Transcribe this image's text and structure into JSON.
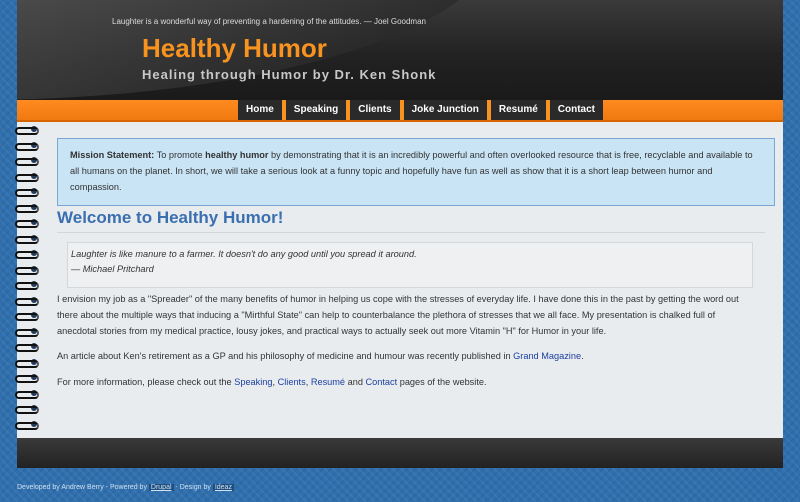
{
  "header": {
    "quote": "Laughter is a wonderful way of preventing a hardening of the attitudes.  — Joel Goodman",
    "site_title": "Healthy Humor",
    "slogan": "Healing through Humor by Dr. Ken Shonk"
  },
  "nav": {
    "items": [
      {
        "label": "Home"
      },
      {
        "label": "Speaking"
      },
      {
        "label": "Clients"
      },
      {
        "label": "Joke Junction"
      },
      {
        "label": "Resumé"
      },
      {
        "label": "Contact"
      }
    ]
  },
  "mission": {
    "label": "Mission Statement:",
    "text_1": " To promote ",
    "strong": "healthy humor",
    "text_2": " by demonstrating that it is an incredibly powerful and often overlooked resource that is free, recyclable and available to all humans on the planet. In short, we will take a serious look at a funny topic and hopefully have fun as well as show that it is a short leap between humor and compassion."
  },
  "page_title": "Welcome to Healthy Humor!",
  "blockquote": {
    "line1": "Laughter is like manure to a farmer. It doesn't do any good until you spread it around.",
    "line2": "— Michael Pritchard"
  },
  "paragraphs": {
    "p1": "I envision my job as a \"Spreader\" of the many benefits of humor in helping us cope with the stresses of everyday life. I have done this in the past by getting the word out there about the multiple ways that inducing a \"Mirthful State\" can help to counterbalance the plethora of stresses that we all face. My presentation is chalked full of anecdotal stories from my medical practice, lousy jokes, and practical ways to actually seek out more Vitamin \"H\" for Humor in your life.",
    "p2_text": "An article about Ken's retirement as a GP and his philosophy of medicine and humour was recently published in ",
    "p2_link": "Grand Magazine",
    "p2_end": ".",
    "p3_text": "For more information, please check out the ",
    "p3_link1": "Speaking",
    "p3_comma1": ", ",
    "p3_link2": "Clients",
    "p3_comma2": ", ",
    "p3_link3": "Resumé",
    "p3_and": " and ",
    "p3_link4": "Contact",
    "p3_end": " pages of the website."
  },
  "footer": {
    "developed": "Developed by Andrew Berry - Powered by ",
    "powered_tag": "Drupal",
    "design": " - Design by ",
    "design_tag": "Ideaz"
  },
  "colors": {
    "accent": "#f7931e",
    "link": "#1b3fa0",
    "title": "#3a6fb0",
    "background": "#2f6fae"
  }
}
